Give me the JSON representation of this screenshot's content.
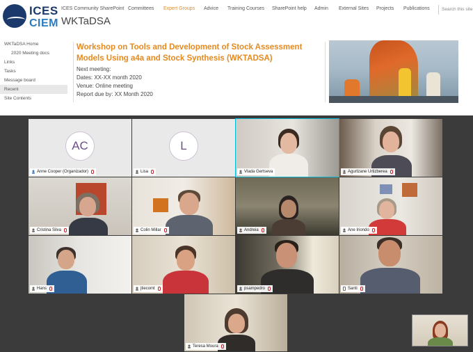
{
  "header": {
    "logo_line1": "ICES",
    "logo_line2": "CIEM",
    "site_title": "WKTaDSA",
    "nav": [
      "ICES Community SharePoint",
      "Committees",
      "Expert Groups",
      "Advice",
      "Training Courses",
      "SharePoint help",
      "Admin",
      "External Sites",
      "Projects",
      "Publications"
    ],
    "active_nav": "Expert Groups",
    "search_placeholder": "Search this site"
  },
  "leftnav": [
    "WKTaDSA Home",
    "2020 Meeting docs",
    "Links",
    "Tasks",
    "Message board",
    "Recent",
    "Site Contents"
  ],
  "workshop": {
    "title": "Workshop on Tools and Development of Stock Assessment Models Using a4a and Stock Synthesis (WKTADSA)",
    "next_meeting": "Next meeting:",
    "dates": "Dates:  XX-XX month 2020",
    "venue": "Venue: Online meeting",
    "report_due": "Report due by:  XX Month 2020"
  },
  "participants": [
    {
      "name": "Anne Cooper (Organizador)",
      "initials": "AC"
    },
    {
      "name": "Lisa",
      "initials": "L"
    },
    {
      "name": "Vlada Gertseva"
    },
    {
      "name": "Agurtzane Urtizberea"
    },
    {
      "name": "Cristina Silva"
    },
    {
      "name": "Colin Millar"
    },
    {
      "name": "Andreia"
    },
    {
      "name": "Ane Iriondo"
    },
    {
      "name": "Hans"
    },
    {
      "name": "jtiecomt"
    },
    {
      "name": "psampedro"
    },
    {
      "name": "Santi"
    },
    {
      "name": "Teresa Moura"
    }
  ],
  "colors": {
    "accent": "#e58a1f",
    "brand_dark": "#1b3a6b",
    "brand_light": "#2b7bc1",
    "meeting_bg": "#3b3b3b",
    "speaker_outline": "#00b7d8",
    "muted_mic": "#c4262e"
  }
}
